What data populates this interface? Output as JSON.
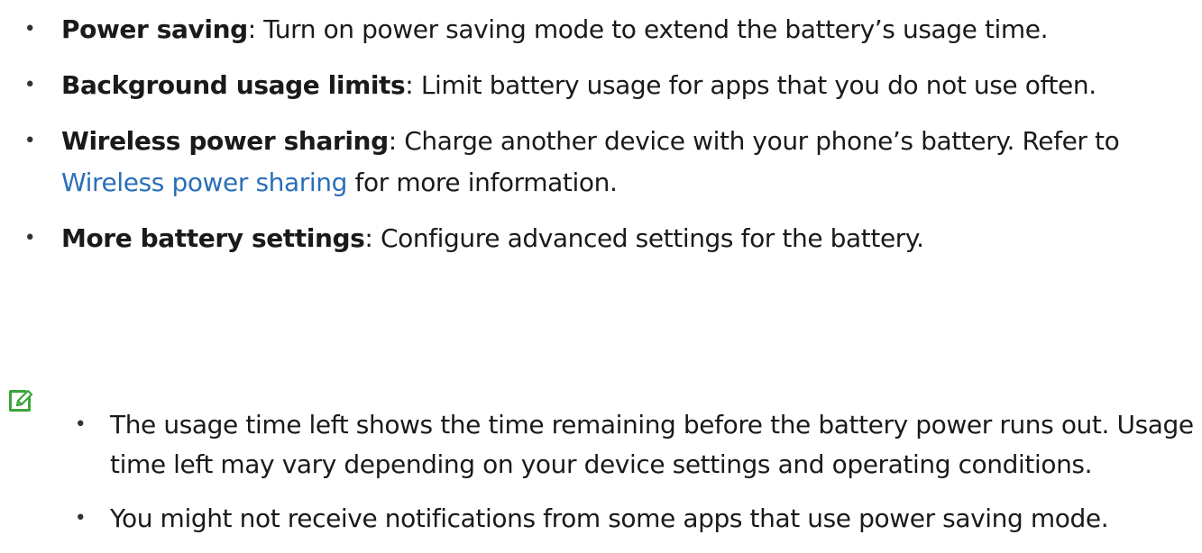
{
  "bullets": [
    {
      "term": "Power saving",
      "desc": ": Turn on power saving mode to extend the battery’s usage time."
    },
    {
      "term": "Background usage limits",
      "desc": ": Limit battery usage for apps that you do not use often."
    },
    {
      "term": "Wireless power sharing",
      "desc": ": Charge another device with your phone’s battery. Refer to ",
      "link": "Wireless power sharing",
      "desc_after": " for more information."
    },
    {
      "term": "More battery settings",
      "desc": ": Configure advanced settings for the battery."
    }
  ],
  "notes": [
    "The usage time left shows the time remaining before the battery power runs out. Usage time left may vary depending on your device settings and operating conditions.",
    "You might not receive notifications from some apps that use power saving mode."
  ],
  "colors": {
    "link": "#2a6fb7",
    "note_icon": "#3aa53a",
    "text": "#1a1a1a"
  },
  "icons": {
    "note": "note-pencil-icon"
  }
}
